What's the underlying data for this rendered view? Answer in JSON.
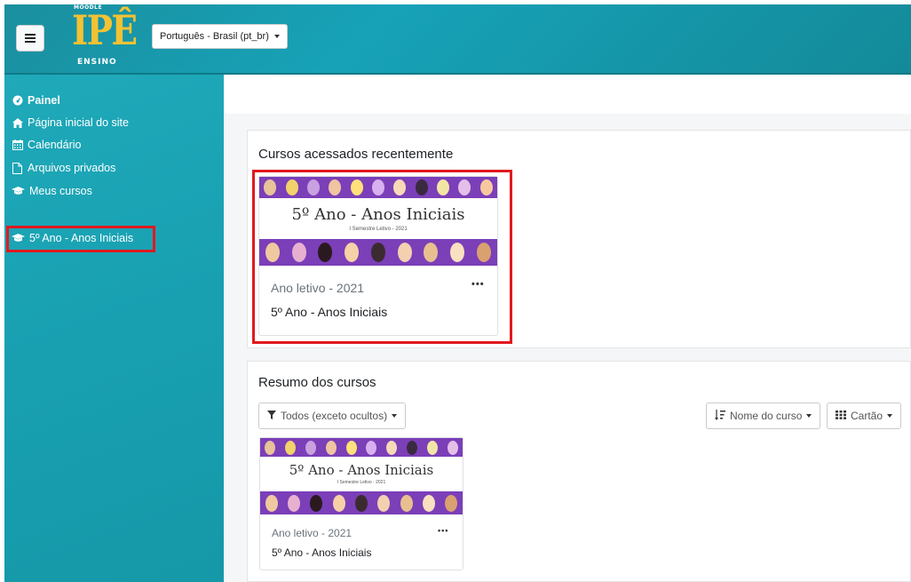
{
  "header": {
    "logo_top": "MOODLE",
    "logo_main": "IPÊ",
    "logo_bottom": "ENSINO",
    "language": "Português - Brasil (pt_br)"
  },
  "sidebar": {
    "items": [
      {
        "label": "Painel",
        "icon": "dashboard-icon"
      },
      {
        "label": "Página inicial do site",
        "icon": "home-icon"
      },
      {
        "label": "Calendário",
        "icon": "calendar-icon"
      },
      {
        "label": "Arquivos privados",
        "icon": "file-icon"
      },
      {
        "label": "Meus cursos",
        "icon": "graduation-cap-icon"
      }
    ],
    "course": {
      "label": "5º Ano - Anos Iniciais",
      "icon": "graduation-cap-icon"
    }
  },
  "recent": {
    "title": "Cursos acessados recentemente",
    "card": {
      "image_title": "5º Ano - Anos Iniciais",
      "image_subtitle": "I Semestre Letivo - 2021",
      "category": "Ano letivo - 2021",
      "name": "5º Ano - Anos Iniciais",
      "menu": "•••"
    }
  },
  "overview": {
    "title": "Resumo dos cursos",
    "filter": "Todos (exceto ocultos)",
    "sort": "Nome do curso",
    "view": "Cartão",
    "card": {
      "image_title": "5º Ano - Anos Iniciais",
      "image_subtitle": "I Semestre Letivo - 2021",
      "category": "Ano letivo - 2021",
      "name": "5º Ano - Anos Iniciais",
      "menu": "•••"
    }
  },
  "colors": {
    "header_teal": "#17a2b8",
    "sidebar_teal": "#1fa9b9",
    "band_purple": "#7b3fb8",
    "highlight_red": "#e0191f",
    "logo_yellow": "#f3c233"
  }
}
